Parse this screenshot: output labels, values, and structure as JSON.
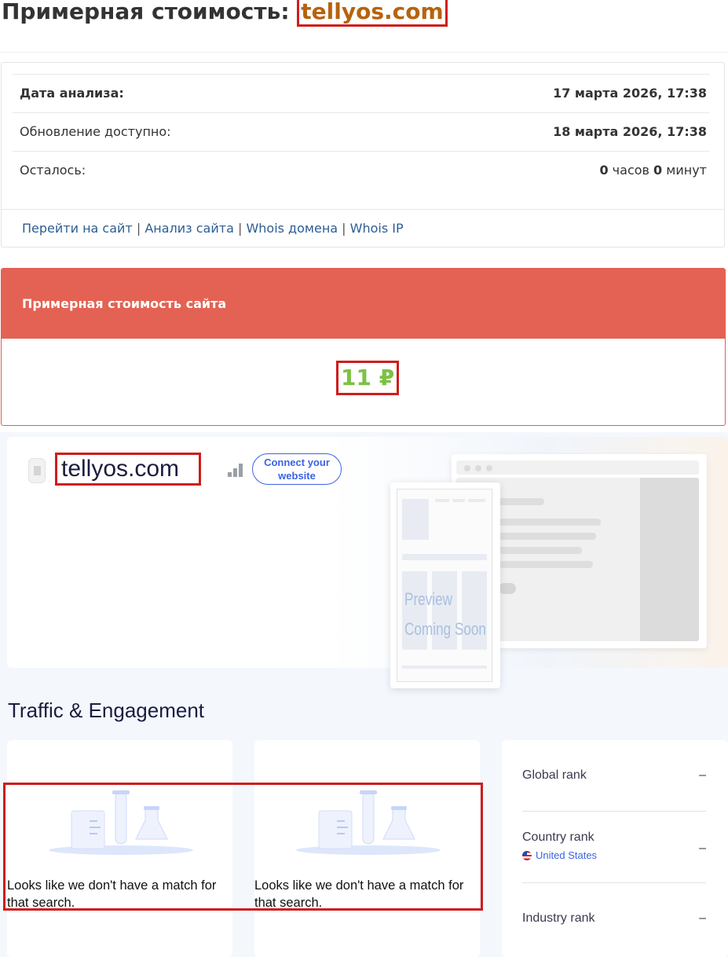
{
  "header": {
    "title_prefix": "Примерная стоимость: ",
    "domain": "tellyos.com"
  },
  "info": {
    "rows": [
      {
        "label": "Дата анализа:",
        "value": "17 марта 2026, 17:38"
      },
      {
        "label": "Обновление доступно:",
        "value": "18 марта 2026, 17:38"
      },
      {
        "label": "Осталось:",
        "hours": "0",
        "hours_unit": " часов ",
        "minutes": "0",
        "minutes_unit": " минут"
      }
    ],
    "links": [
      "Перейти на сайт",
      "Анализ сайта",
      "Whois домена",
      "Whois IP"
    ],
    "link_separator": " | "
  },
  "value_card": {
    "heading": "Примерная стоимость сайта",
    "amount": "11 ₽"
  },
  "widget": {
    "domain": "tellyos.com",
    "connect_button": "Connect your website",
    "preview_line1": "Preview",
    "preview_line2": "Coming Soon",
    "section_title": "Traffic & Engagement",
    "no_match_text": "Looks like we don't have a match for that search.",
    "ranks": [
      {
        "label": "Global rank",
        "value": "–"
      },
      {
        "label": "Country rank",
        "sub": "United States",
        "value": "–"
      },
      {
        "label": "Industry rank",
        "value": "–"
      }
    ]
  },
  "colors": {
    "domain_accent": "#b8620c",
    "value_header": "#e46253",
    "amount": "#7cc243",
    "highlight_border": "#d01c1c",
    "link": "#2d5d93",
    "connect": "#3b63e3"
  }
}
